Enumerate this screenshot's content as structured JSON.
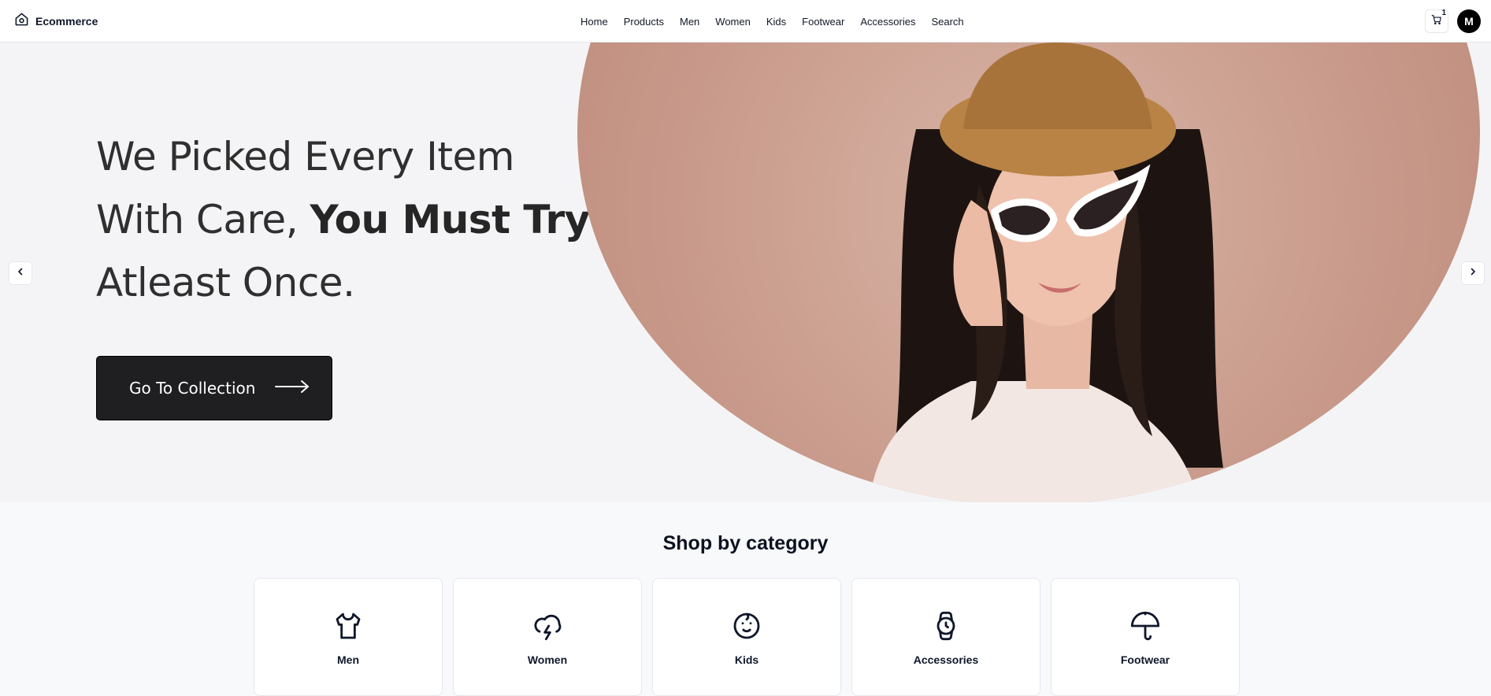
{
  "header": {
    "brand": "Ecommerce",
    "brand_icon": "home-icon",
    "nav": [
      "Home",
      "Products",
      "Men",
      "Women",
      "Kids",
      "Footwear",
      "Accessories",
      "Search"
    ],
    "cart": {
      "icon": "cart-icon",
      "count": "1"
    },
    "avatar": "M"
  },
  "hero": {
    "headline_line1": "We Picked Every Item",
    "headline_line2_regular": "With Care, ",
    "headline_line2_bold": "You Must Try",
    "headline_line3": "Atleast Once.",
    "cta_label": "Go To Collection",
    "cta_icon": "arrow-right-icon",
    "image_description_icon": "hero-model-image",
    "prev_icon": "chevron-left-icon",
    "next_icon": "chevron-right-icon"
  },
  "categories": {
    "title": "Shop by category",
    "items": [
      {
        "label": "Men",
        "icon": "shirt-icon"
      },
      {
        "label": "Women",
        "icon": "cloud-lightning-icon"
      },
      {
        "label": "Kids",
        "icon": "baby-icon"
      },
      {
        "label": "Accessories",
        "icon": "watch-icon"
      },
      {
        "label": "Footwear",
        "icon": "umbrella-icon"
      }
    ]
  },
  "colors": {
    "header_bg": "#ffffff",
    "hero_bg": "#f4f4f6",
    "cta_bg": "#1f1f22",
    "page_bg": "#f8f9fb",
    "avatar_bg": "#000000"
  }
}
